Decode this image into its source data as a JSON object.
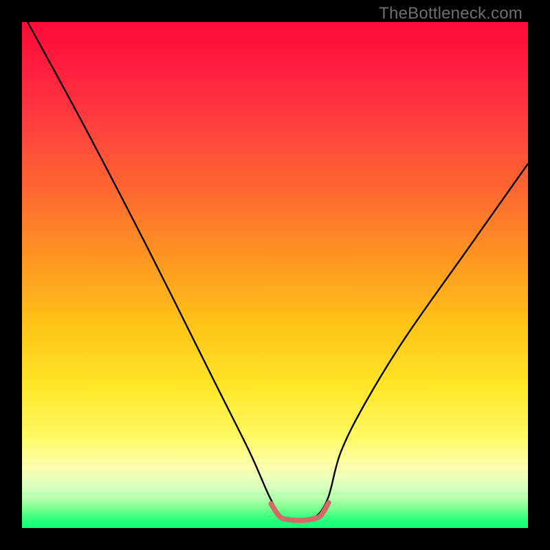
{
  "watermark": "TheBottleneck.com",
  "chart_data": {
    "type": "line",
    "title": "",
    "xlabel": "",
    "ylabel": "",
    "xlim": [
      0,
      100
    ],
    "ylim": [
      0,
      100
    ],
    "series": [
      {
        "name": "bottleneck-curve",
        "x": [
          0,
          12,
          25,
          38,
          45,
          49,
          51.5,
          54.5,
          58,
          60.5,
          63,
          68,
          76,
          88,
          100
        ],
        "y": [
          102,
          80,
          55,
          29,
          15,
          6,
          2.2,
          1.6,
          2.2,
          6,
          15,
          25,
          38,
          55,
          72
        ]
      },
      {
        "name": "flat-bottom-highlight",
        "x": [
          49.2,
          51,
          53,
          55,
          57,
          59,
          60.6
        ],
        "y": [
          4.8,
          2.2,
          1.6,
          1.5,
          1.7,
          2.4,
          5.0
        ]
      }
    ],
    "gradient_stops": [
      {
        "pct": 0,
        "color": "#ff0a3a"
      },
      {
        "pct": 18,
        "color": "#ff3840"
      },
      {
        "pct": 48,
        "color": "#ff9a20"
      },
      {
        "pct": 72,
        "color": "#ffe628"
      },
      {
        "pct": 88,
        "color": "#fcffb0"
      },
      {
        "pct": 96,
        "color": "#7aff90"
      },
      {
        "pct": 100,
        "color": "#12ff76"
      }
    ],
    "green_band_colors": [
      "#d8ffc0",
      "#b8ffb0",
      "#98ff9c",
      "#78ff90",
      "#50ff84",
      "#30ff7c",
      "#18ff76",
      "#12ff76"
    ]
  }
}
